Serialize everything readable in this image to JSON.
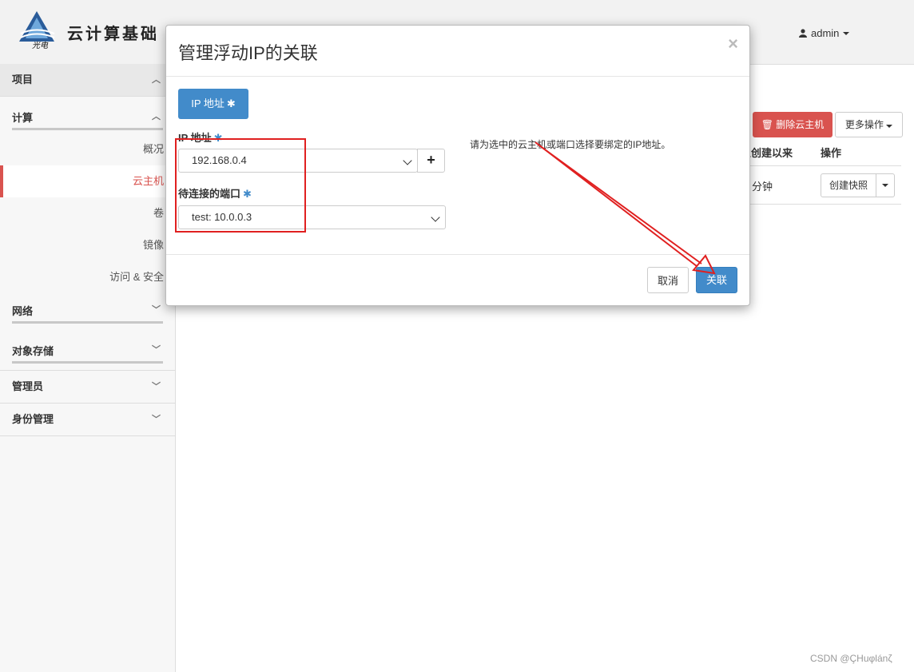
{
  "header": {
    "logo_caption": "光电",
    "title": "云计算基础",
    "user": "admin"
  },
  "sidebar": {
    "project": "项目",
    "compute": "计算",
    "compute_items": [
      "概况",
      "云主机",
      "卷",
      "镜像",
      "访问 & 安全"
    ],
    "active_item": "云主机",
    "network": "网络",
    "object_storage": "对象存储",
    "admin": "管理员",
    "identity": "身份管理"
  },
  "background": {
    "delete_button": "删除云主机",
    "more_button": "更多操作",
    "col_created": "从创建以来",
    "col_actions": "操作",
    "row_time": "分钟",
    "snapshot_button": "创建快照"
  },
  "modal": {
    "title": "管理浮动IP的关联",
    "tab_label": "IP 地址",
    "ip_label": "IP 地址",
    "ip_value": "192.168.0.4",
    "port_label": "待连接的端口",
    "port_value": "test: 10.0.0.3",
    "help": "请为选中的云主机或端口选择要绑定的IP地址。",
    "cancel": "取消",
    "submit": "关联",
    "required_mark": "✱",
    "close": "×"
  },
  "watermark": "CSDN @ÇHuφlánζ",
  "colors": {
    "accent": "#428bca",
    "danger": "#d9534f",
    "annotation": "#e02020"
  }
}
